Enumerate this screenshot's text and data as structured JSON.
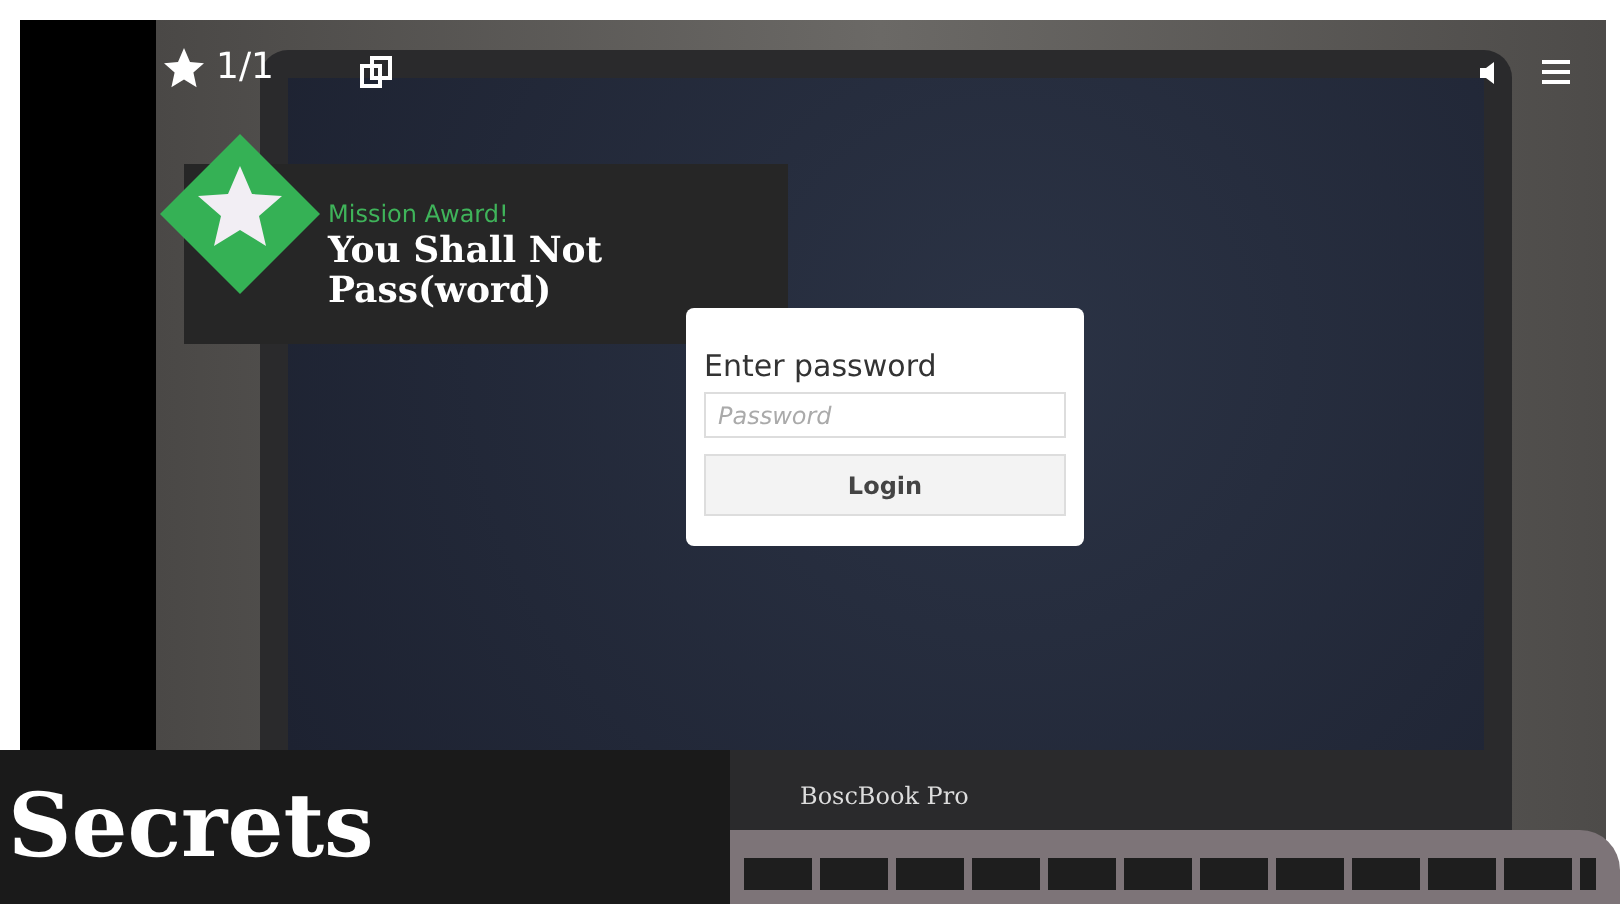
{
  "player": {
    "progress": "1/1"
  },
  "award": {
    "label": "Mission Award!",
    "title": "You Shall Not Pass(word)"
  },
  "login": {
    "heading": "Enter password",
    "placeholder": "Password",
    "button": "Login"
  },
  "laptop": {
    "brand": "BoscBook Pro"
  },
  "caption": {
    "title": "Secrets"
  }
}
